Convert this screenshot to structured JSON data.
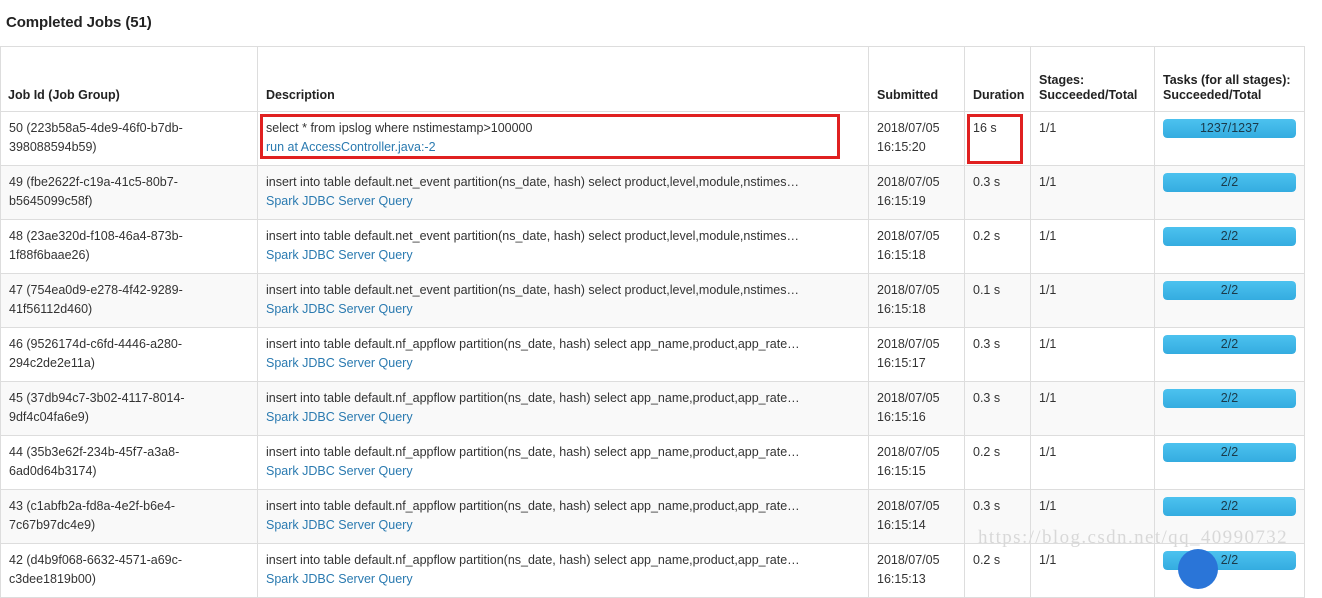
{
  "page": {
    "title": "Completed Jobs (51)"
  },
  "table": {
    "columns": [
      {
        "key": "jobid",
        "label": "Job Id (Job Group)"
      },
      {
        "key": "desc",
        "label": "Description"
      },
      {
        "key": "sub",
        "label": "Submitted"
      },
      {
        "key": "dur",
        "label": "Duration"
      },
      {
        "key": "stages",
        "label": "Stages:\nSucceeded/Total"
      },
      {
        "key": "tasks",
        "label": "Tasks (for all stages):\nSucceeded/Total"
      }
    ],
    "rows": [
      {
        "job_id": "50 (223b58a5-4de9-46f0-b7db-398088594b59)",
        "description": "select * from ipslog where nstimestamp>100000",
        "description_link": "run at AccessController.java:-2",
        "submitted": "2018/07/05 16:15:20",
        "duration": "16 s",
        "stages": "1/1",
        "tasks_label": "1237/1237",
        "tasks_percent": 100,
        "highlight_description": true,
        "highlight_duration": true
      },
      {
        "job_id": "49 (fbe2622f-c19a-41c5-80b7-b5645099c58f)",
        "description": "insert into table default.net_event partition(ns_date, hash) select product,level,module,nstimes…",
        "description_link": "Spark JDBC Server Query",
        "submitted": "2018/07/05 16:15:19",
        "duration": "0.3 s",
        "stages": "1/1",
        "tasks_label": "2/2",
        "tasks_percent": 100,
        "highlight_description": false,
        "highlight_duration": false
      },
      {
        "job_id": "48 (23ae320d-f108-46a4-873b-1f88f6baae26)",
        "description": "insert into table default.net_event partition(ns_date, hash) select product,level,module,nstimes…",
        "description_link": "Spark JDBC Server Query",
        "submitted": "2018/07/05 16:15:18",
        "duration": "0.2 s",
        "stages": "1/1",
        "tasks_label": "2/2",
        "tasks_percent": 100,
        "highlight_description": false,
        "highlight_duration": false
      },
      {
        "job_id": "47 (754ea0d9-e278-4f42-9289-41f56112d460)",
        "description": "insert into table default.net_event partition(ns_date, hash) select product,level,module,nstimes…",
        "description_link": "Spark JDBC Server Query",
        "submitted": "2018/07/05 16:15:18",
        "duration": "0.1 s",
        "stages": "1/1",
        "tasks_label": "2/2",
        "tasks_percent": 100,
        "highlight_description": false,
        "highlight_duration": false
      },
      {
        "job_id": "46 (9526174d-c6fd-4446-a280-294c2de2e11a)",
        "description": "insert into table default.nf_appflow partition(ns_date, hash) select app_name,product,app_rate…",
        "description_link": "Spark JDBC Server Query",
        "submitted": "2018/07/05 16:15:17",
        "duration": "0.3 s",
        "stages": "1/1",
        "tasks_label": "2/2",
        "tasks_percent": 100,
        "highlight_description": false,
        "highlight_duration": false
      },
      {
        "job_id": "45 (37db94c7-3b02-4117-8014-9df4c04fa6e9)",
        "description": "insert into table default.nf_appflow partition(ns_date, hash) select app_name,product,app_rate…",
        "description_link": "Spark JDBC Server Query",
        "submitted": "2018/07/05 16:15:16",
        "duration": "0.3 s",
        "stages": "1/1",
        "tasks_label": "2/2",
        "tasks_percent": 100,
        "highlight_description": false,
        "highlight_duration": false
      },
      {
        "job_id": "44 (35b3e62f-234b-45f7-a3a8-6ad0d64b3174)",
        "description": "insert into table default.nf_appflow partition(ns_date, hash) select app_name,product,app_rate…",
        "description_link": "Spark JDBC Server Query",
        "submitted": "2018/07/05 16:15:15",
        "duration": "0.2 s",
        "stages": "1/1",
        "tasks_label": "2/2",
        "tasks_percent": 100,
        "highlight_description": false,
        "highlight_duration": false
      },
      {
        "job_id": "43 (c1abfb2a-fd8a-4e2f-b6e4-7c67b97dc4e9)",
        "description": "insert into table default.nf_appflow partition(ns_date, hash) select app_name,product,app_rate…",
        "description_link": "Spark JDBC Server Query",
        "submitted": "2018/07/05 16:15:14",
        "duration": "0.3 s",
        "stages": "1/1",
        "tasks_label": "2/2",
        "tasks_percent": 100,
        "highlight_description": false,
        "highlight_duration": false
      },
      {
        "job_id": "42 (d4b9f068-6632-4571-a69c-c3dee1819b00)",
        "description": "insert into table default.nf_appflow partition(ns_date, hash) select app_name,product,app_rate…",
        "description_link": "Spark JDBC Server Query",
        "submitted": "2018/07/05 16:15:13",
        "duration": "0.2 s",
        "stages": "1/1",
        "tasks_label": "2/2",
        "tasks_percent": 100,
        "highlight_description": false,
        "highlight_duration": false
      }
    ]
  },
  "watermark": {
    "text": "https://blog.csdn.net/qq_40990732"
  },
  "colors": {
    "highlight_border": "#e02020",
    "progress_fill": "#34ace0",
    "link": "#2a7ab0",
    "row_alt": "#f9f9f9",
    "border": "#dddddd"
  }
}
